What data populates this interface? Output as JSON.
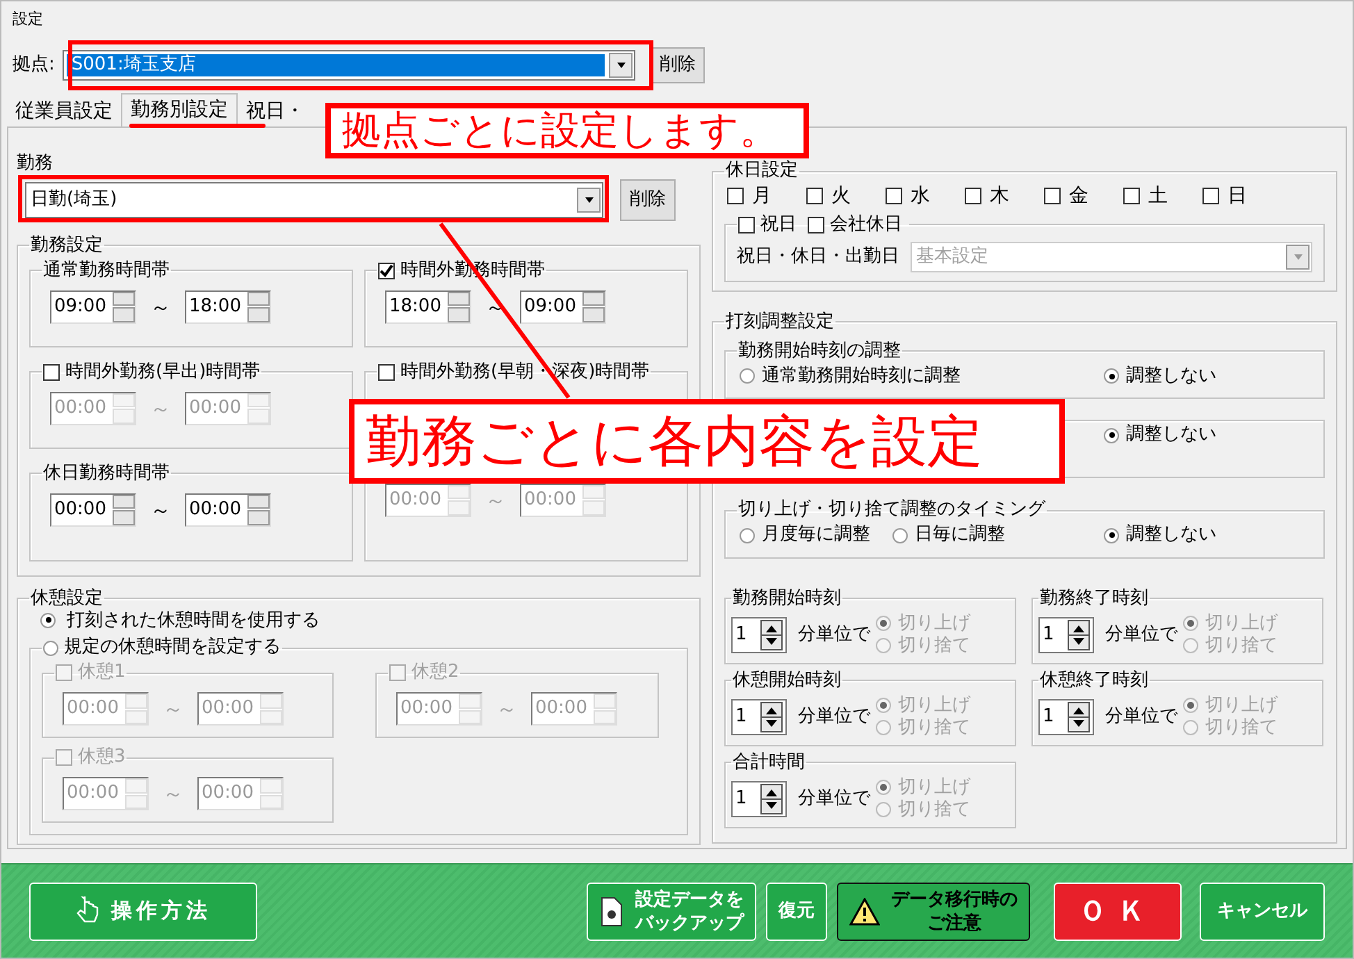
{
  "window": {
    "title": "設定"
  },
  "branch": {
    "label": "拠点:",
    "value": "S001:埼玉支店",
    "delete_button": "削除"
  },
  "tabs": [
    {
      "label": "従業員設定",
      "selected": false
    },
    {
      "label": "勤務別設定",
      "selected": true
    },
    {
      "label": "祝日・",
      "selected": false
    }
  ],
  "shift": {
    "label": "勤務",
    "value": "日勤(埼玉)",
    "delete_button": "削除"
  },
  "shift_settings": {
    "title": "勤務設定",
    "bands": [
      {
        "kind": "plain",
        "title": "通常勤務時間帯",
        "disabled": false,
        "from": "09:00",
        "separator": "～",
        "to": "18:00"
      },
      {
        "kind": "checkbox",
        "title": "時間外勤務時間帯",
        "checked": true,
        "disabled": false,
        "from": "18:00",
        "separator": "～",
        "to": "09:00"
      },
      {
        "kind": "checkbox",
        "title": "時間外勤務(早出)時間帯",
        "checked": false,
        "disabled": true,
        "from": "00:00",
        "separator": "～",
        "to": "00:00"
      },
      {
        "kind": "checkbox",
        "title": "時間外勤務(早朝・深夜)時間帯",
        "checked": false
      },
      {
        "kind": "plain",
        "title": "休日勤務時間帯",
        "disabled": false,
        "from": "00:00",
        "separator": "～",
        "to": "00:00"
      },
      {
        "kind": "plain",
        "disabled": true,
        "from": "00:00",
        "separator": "～",
        "to": "00:00"
      }
    ]
  },
  "breaks": {
    "title": "休憩設定",
    "options": [
      {
        "label": "打刻された休憩時間を使用する",
        "selected": true
      },
      {
        "label": "規定の休憩時間を設定する",
        "selected": false
      }
    ],
    "items": [
      {
        "label": "休憩1",
        "checked": false,
        "disabled": true,
        "from": "00:00",
        "separator": "～",
        "to": "00:00"
      },
      {
        "label": "休憩2",
        "checked": false,
        "disabled": true,
        "from": "00:00",
        "separator": "～",
        "to": "00:00"
      },
      {
        "label": "休憩3",
        "checked": false,
        "disabled": true,
        "from": "00:00",
        "separator": "～",
        "to": "00:00"
      }
    ]
  },
  "holidays": {
    "title": "休日設定",
    "days": [
      {
        "label": "月",
        "checked": false
      },
      {
        "label": "火",
        "checked": false
      },
      {
        "label": "水",
        "checked": false
      },
      {
        "label": "木",
        "checked": false
      },
      {
        "label": "金",
        "checked": false
      },
      {
        "label": "土",
        "checked": false
      },
      {
        "label": "日",
        "checked": false
      }
    ],
    "extra": [
      {
        "label": "祝日",
        "checked": false
      },
      {
        "label": "会社休日",
        "checked": false
      }
    ],
    "calendar_label": "祝日・休日・出勤日",
    "calendar_value": "基本設定"
  },
  "rounding": {
    "title": "打刻調整設定",
    "adjustments": [
      {
        "title": "勤務開始時刻の調整",
        "options": [
          {
            "label": "通常勤務開始時刻に調整",
            "selected": false
          },
          {
            "label": "調整しない",
            "selected": true
          }
        ]
      },
      {
        "options": [
          {
            "label": "調整しない",
            "selected": true
          }
        ]
      },
      {
        "title": "切り上げ・切り捨て調整のタイミング",
        "options": [
          {
            "label": "月度毎に調整",
            "selected": false
          },
          {
            "label": "日毎に調整",
            "selected": false
          },
          {
            "label": "調整しない",
            "selected": true
          }
        ]
      }
    ],
    "units": [
      {
        "title": "勤務開始時刻",
        "value": "1",
        "unit": "分単位で",
        "disabled": true,
        "options": [
          {
            "label": "切り上げ",
            "selected": true
          },
          {
            "label": "切り捨て",
            "selected": false
          }
        ]
      },
      {
        "title": "勤務終了時刻",
        "value": "1",
        "unit": "分単位で",
        "disabled": true,
        "options": [
          {
            "label": "切り上げ",
            "selected": true
          },
          {
            "label": "切り捨て",
            "selected": false
          }
        ]
      },
      {
        "title": "休憩開始時刻",
        "value": "1",
        "unit": "分単位で",
        "disabled": true,
        "options": [
          {
            "label": "切り上げ",
            "selected": true
          },
          {
            "label": "切り捨て",
            "selected": false
          }
        ]
      },
      {
        "title": "休憩終了時刻",
        "value": "1",
        "unit": "分単位で",
        "disabled": true,
        "options": [
          {
            "label": "切り上げ",
            "selected": true
          },
          {
            "label": "切り捨て",
            "selected": false
          }
        ]
      },
      {
        "title": "合計時間",
        "value": "1",
        "unit": "分単位で",
        "disabled": true,
        "options": [
          {
            "label": "切り上げ",
            "selected": true
          },
          {
            "label": "切り捨て",
            "selected": false
          }
        ]
      }
    ]
  },
  "footer_buttons": [
    {
      "kind": "help",
      "lines": [
        "操作方法"
      ]
    },
    {
      "kind": "backup",
      "lines": [
        "設定データを",
        "バックアップ"
      ]
    },
    {
      "kind": "restore",
      "lines": [
        "復元"
      ]
    },
    {
      "kind": "notice",
      "lines": [
        "データ移行時の",
        "ご注意"
      ]
    },
    {
      "kind": "ok",
      "lines": [
        "ＯＫ"
      ]
    },
    {
      "kind": "cancel",
      "lines": [
        "キャンセル"
      ]
    }
  ],
  "annotations": [
    {
      "text": "拠点ごとに設定します。"
    },
    {
      "text": "勤務ごとに各内容を設定"
    }
  ]
}
